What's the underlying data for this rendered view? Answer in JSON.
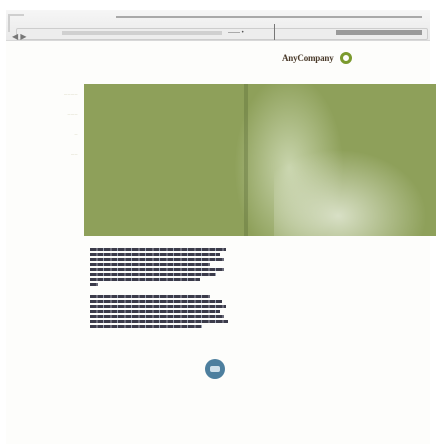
{
  "browser": {
    "back_label": "◀ ▶",
    "middle_label": "—— •"
  },
  "header": {
    "logo_text": "AnyCompany"
  },
  "nav": {
    "items": [
      {
        "label": "————"
      },
      {
        "label": "———"
      },
      {
        "label": "—"
      },
      {
        "label": "——"
      }
    ]
  },
  "colors": {
    "accent": "#7b9a2e",
    "hero_bg": "#8ea05a",
    "button": "#4d7f9e"
  },
  "icons": {
    "logo": "ring-icon",
    "action": "circle-arrow-icon"
  }
}
